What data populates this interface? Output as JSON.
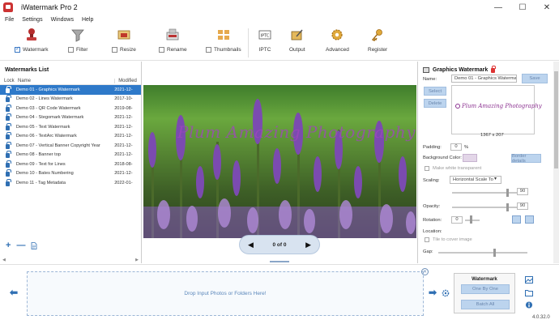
{
  "window": {
    "title": "iWatermark Pro 2",
    "controls": [
      "—",
      "☐",
      "✕"
    ]
  },
  "menu": [
    "File",
    "Settings",
    "Windows",
    "Help"
  ],
  "toolbar": {
    "items": [
      {
        "label": "Watermark",
        "checked": true,
        "icon": "stamp-icon"
      },
      {
        "label": "Filter",
        "checked": false,
        "icon": "funnel-icon"
      },
      {
        "label": "Resize",
        "checked": false,
        "icon": "resize-icon"
      },
      {
        "label": "Rename",
        "checked": false,
        "icon": "rename-icon"
      },
      {
        "label": "Thumbnails",
        "checked": false,
        "icon": "thumbnails-icon"
      },
      {
        "label": "IPTC",
        "icon": "iptc-icon"
      },
      {
        "label": "Output",
        "icon": "output-icon"
      },
      {
        "label": "Advanced",
        "icon": "gear-icon"
      },
      {
        "label": "Register",
        "icon": "key-icon"
      }
    ]
  },
  "watermarks": {
    "title": "Watermarks List",
    "columns": {
      "lock": "Lock",
      "name": "Name",
      "modified": "Modified"
    },
    "rows": [
      {
        "name": "Demo 01 - Graphics Watermark",
        "modified": "2021-12-",
        "selected": true
      },
      {
        "name": "Demo 02 - Lines Watermark",
        "modified": "2017-10-"
      },
      {
        "name": "Demo 03 - QR Code Watermark",
        "modified": "2019-08-"
      },
      {
        "name": "Demo 04 - Stegomark Watermark",
        "modified": "2021-12-"
      },
      {
        "name": "Demo 05 - Text Watermark",
        "modified": "2021-12-"
      },
      {
        "name": "Demo 06 - TextArc Watermark",
        "modified": "2021-12-"
      },
      {
        "name": "Demo 07 - Vertical Banner Copyright Year",
        "modified": "2021-12-"
      },
      {
        "name": "Demo 08 - Banner top",
        "modified": "2021-12-"
      },
      {
        "name": "Demo 09 - Text for Lines",
        "modified": "2018-08-"
      },
      {
        "name": "Demo 10 - Bates Numbering",
        "modified": "2021-12-"
      },
      {
        "name": "Demo 11 - Tag Metadata",
        "modified": "2022-01-"
      }
    ],
    "actions": [
      "+",
      "—"
    ]
  },
  "preview": {
    "watermark_text": "Plum Amazing Photography",
    "page": "0 of 0"
  },
  "panel": {
    "title": "Graphics Watermark",
    "name_label": "Name:",
    "name_value": "Demo 01 - Graphics Watermark",
    "save": "Save",
    "select": "Select",
    "delete": "Delete",
    "graphic_text": "Plum Amazing Photography",
    "dimensions": "1367 x 207",
    "padding_label": "Padding:",
    "padding_value": "0",
    "padding_unit": "%",
    "bg_label": "Background Color:",
    "border_btn": "Border details",
    "white_transparent": "Make white transparent",
    "scaling_label": "Scaling:",
    "scaling_value": "Horizontal Scale To",
    "scaling_num": "90",
    "opacity_label": "Opacity:",
    "opacity_num": "90",
    "rotation_label": "Rotation:",
    "rotation_num": "0",
    "location_label": "Location:",
    "tile_label": "Tile to cover image",
    "gap_label": "Gap:"
  },
  "bottom": {
    "drop_text": "Drop Input Photos or Folders Here!",
    "watermark_box_title": "Watermark",
    "one_by_one": "One By One",
    "batch_all": "Batch All",
    "version": "4.0.32.0"
  }
}
